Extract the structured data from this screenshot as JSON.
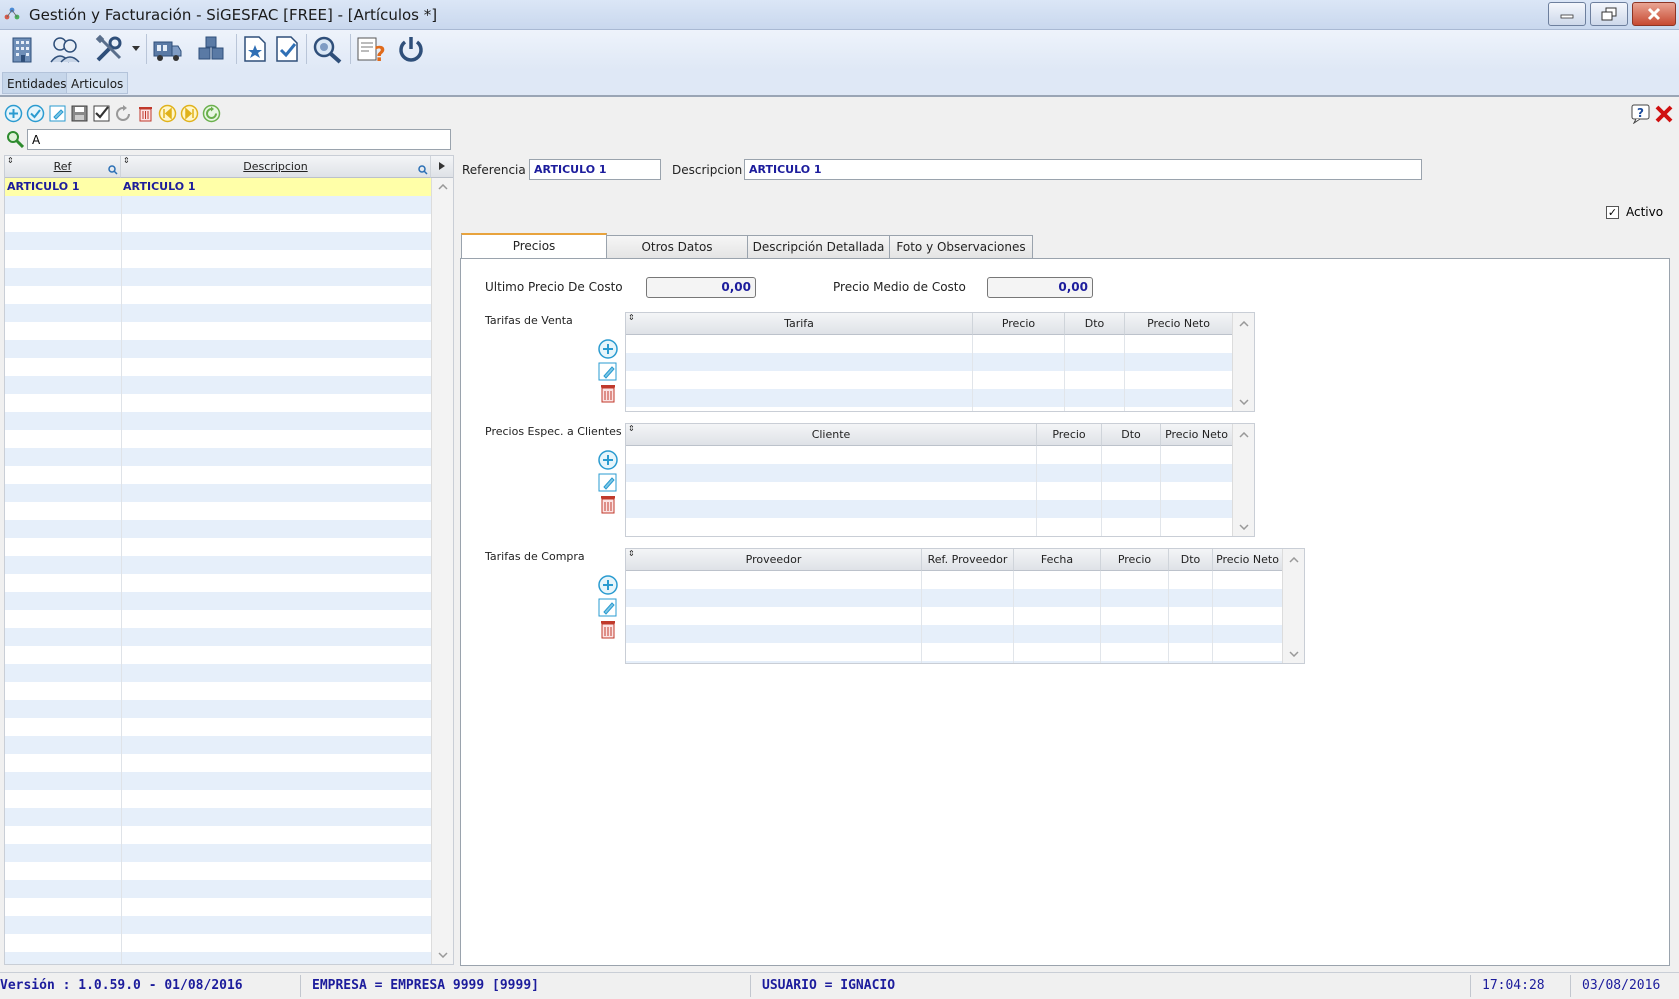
{
  "window": {
    "title": "Gestión y Facturación - SiGESFAC [FREE] - [Artículos *]",
    "controls": [
      "minimize-icon",
      "restore-icon",
      "close-icon"
    ]
  },
  "main_toolbar": {
    "icons": [
      "building-icon",
      "users-icon",
      "tools-icon",
      "chevron-down-icon",
      "delivery-truck-icon",
      "boxes-icon",
      "document-star-icon",
      "document-check-icon",
      "magnifier-icon",
      "report-help-icon",
      "power-icon"
    ]
  },
  "module_tabs": [
    {
      "label": "Entidades"
    },
    {
      "label": "Articulos"
    }
  ],
  "record_toolbar": {
    "icons": [
      "add-icon",
      "confirm-icon",
      "edit-icon",
      "save-icon",
      "check-icon",
      "undo-icon",
      "delete-icon",
      "first-icon",
      "last-icon",
      "refresh-icon"
    ]
  },
  "search": {
    "value": "A"
  },
  "list": {
    "columns": [
      "Ref",
      "Descripcion"
    ],
    "rows": [
      {
        "ref": "ARTICULO 1",
        "descripcion": "ARTICULO 1"
      }
    ]
  },
  "form": {
    "referencia_label": "Referencia",
    "referencia_value": "ARTICULO 1",
    "descripcion_label": "Descripcion",
    "descripcion_value": "ARTICULO 1",
    "activo_label": "Activo",
    "activo_checked": true
  },
  "detail_tabs": [
    {
      "label": "Precios",
      "active": true
    },
    {
      "label": "Otros Datos",
      "active": false
    },
    {
      "label": "Descripción Detallada",
      "active": false
    },
    {
      "label": "Foto y Observaciones",
      "active": false
    }
  ],
  "precios": {
    "ultimo_costo_label": "Ultimo Precio De Costo",
    "ultimo_costo_value": "0,00",
    "medio_costo_label": "Precio Medio de Costo",
    "medio_costo_value": "0,00",
    "tarifas_venta": {
      "label": "Tarifas de Venta",
      "columns": [
        "Tarifa",
        "Precio",
        "Dto",
        "Precio Neto"
      ]
    },
    "precios_clientes": {
      "label": "Precios Espec. a Clientes",
      "columns": [
        "Cliente",
        "Precio",
        "Dto",
        "Precio Neto"
      ]
    },
    "tarifas_compra": {
      "label": "Tarifas de Compra",
      "columns": [
        "Proveedor",
        "Ref. Proveedor",
        "Fecha",
        "Precio",
        "Dto",
        "Precio Neto"
      ]
    }
  },
  "statusbar": {
    "version": "Versión : 1.0.59.0 - 01/08/2016",
    "empresa": "EMPRESA =  EMPRESA 9999 [9999]",
    "usuario": "USUARIO = IGNACIO",
    "hora": "17:04:28",
    "fecha": "03/08/2016"
  },
  "colors": {
    "accent_text": "#1c1c9c",
    "selected_row": "#ffffa8",
    "stripe": "#e6effa",
    "active_tab_border": "#e8a33d"
  }
}
